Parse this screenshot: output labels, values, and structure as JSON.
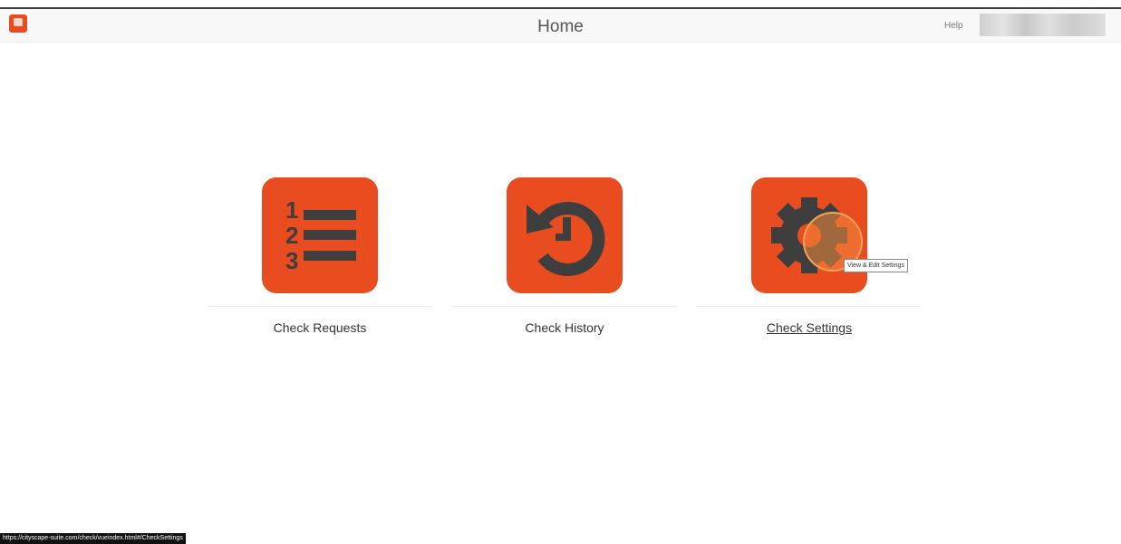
{
  "header": {
    "title": "Home",
    "help_label": "Help",
    "logo_icon": "app-logo-icon",
    "user_menu_state": "redacted"
  },
  "tiles": [
    {
      "label": "Check Requests",
      "icon": "numbered-list-icon"
    },
    {
      "label": "Check History",
      "icon": "history-icon"
    },
    {
      "label": "Check Settings",
      "icon": "gear-icon"
    }
  ],
  "tooltip": {
    "text": "View & Edit Settings"
  },
  "status_bar": {
    "url": "https://cityscape-suite.com/check/vueindex.html#/CheckSettings"
  },
  "colors": {
    "accent": "#e84c1f",
    "icon_dark": "#3e3e3e",
    "header_bg": "#f8f8f8",
    "text": "#333333"
  }
}
